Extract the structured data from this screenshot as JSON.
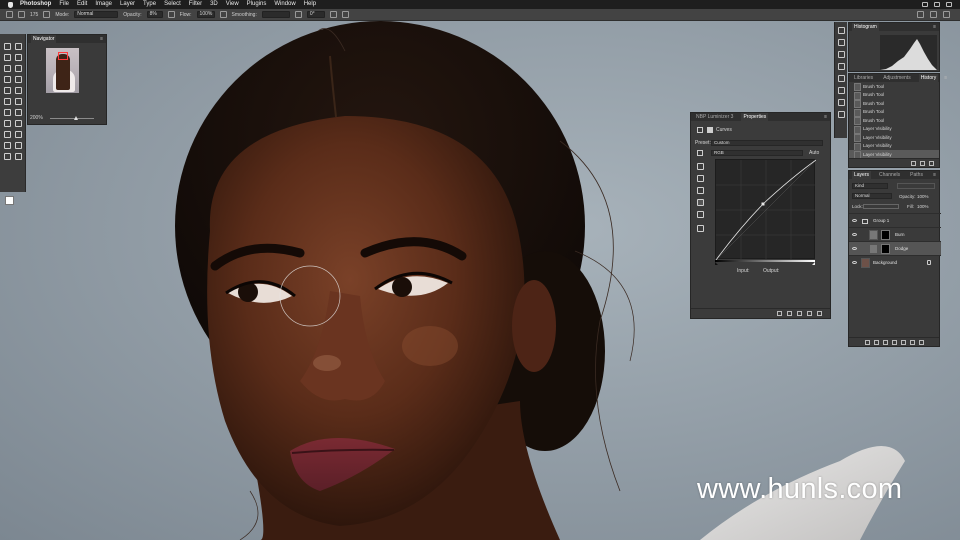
{
  "menubar": {
    "items": [
      "Photoshop",
      "File",
      "Edit",
      "Image",
      "Layer",
      "Type",
      "Select",
      "Filter",
      "3D",
      "View",
      "Plugins",
      "Window",
      "Help"
    ]
  },
  "options": {
    "mode_label": "Mode:",
    "mode_value": "Normal",
    "opacity_label": "Opacity:",
    "opacity_value": "8%",
    "flow_label": "Flow:",
    "flow_value": "100%",
    "smoothing_label": "Smoothing:",
    "angle_value": "0°",
    "brush_size": "175"
  },
  "navigator": {
    "tab": "Navigator",
    "zoom": "200%"
  },
  "histogram": {
    "tab": "Histogram"
  },
  "history": {
    "tabs": [
      "Libraries",
      "Adjustments",
      "History"
    ],
    "steps": [
      "Brush Tool",
      "Brush Tool",
      "Brush Tool",
      "Brush Tool",
      "Brush Tool",
      "Layer Visibility",
      "Layer Visibility",
      "Layer Visibility",
      "Layer Visibility"
    ]
  },
  "properties": {
    "tabs": [
      "NBP Luminizer 3",
      "Properties"
    ],
    "adjustment": "Curves",
    "preset_label": "Preset:",
    "preset_value": "Custom",
    "channel_value": "RGB",
    "auto_label": "Auto",
    "input_label": "Input:",
    "output_label": "Output:"
  },
  "layers": {
    "tabs": [
      "Layers",
      "Channels",
      "Paths"
    ],
    "filter_value": "Kind",
    "blend_value": "Normal",
    "opacity_label": "Opacity:",
    "opacity_value": "100%",
    "lock_label": "Lock:",
    "fill_label": "Fill:",
    "fill_value": "100%",
    "items": [
      {
        "name": "Group 1"
      },
      {
        "name": "Burn"
      },
      {
        "name": "Dodge"
      },
      {
        "name": "Background"
      }
    ]
  },
  "watermark": "www.hunls.com",
  "colors": {
    "accent": "#ff3b3b",
    "panel": "#3a3a3a",
    "menubar": "#1e1e1e"
  }
}
